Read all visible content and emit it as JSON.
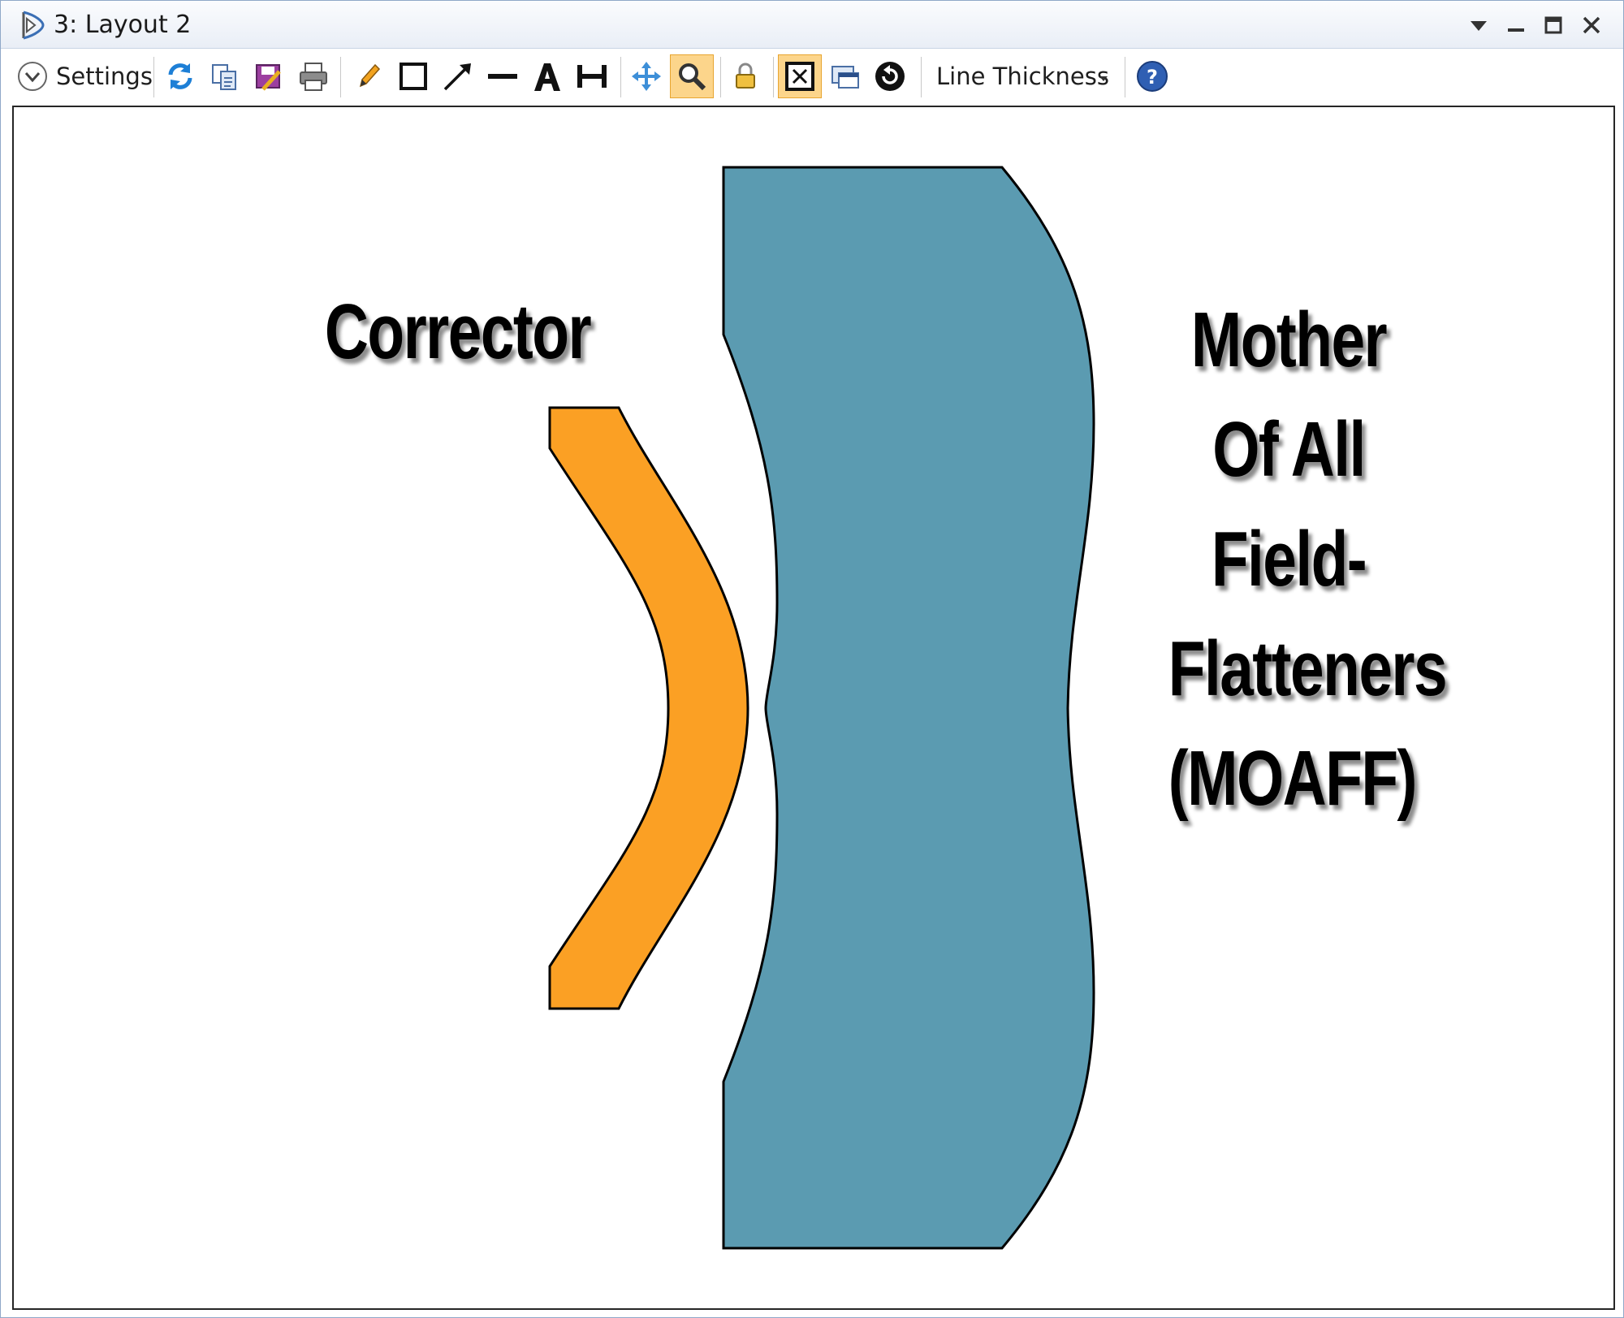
{
  "window": {
    "title": "3: Layout 2",
    "controls": [
      "chevron-down-icon",
      "minimize-icon",
      "maximize-icon",
      "close-icon"
    ]
  },
  "toolbar": {
    "settings_label": "Settings",
    "line_thickness_label": "Line Thickness",
    "icons": [
      "refresh-icon",
      "copy-icon",
      "save-icon",
      "print-icon",
      "pencil-icon",
      "rectangle-icon",
      "arrow-icon",
      "line-icon",
      "text-icon",
      "dimension-icon",
      "pan-icon",
      "zoom-icon",
      "lock-icon",
      "fit-icon",
      "window-icon",
      "reset-icon",
      "help-icon"
    ],
    "active": [
      "zoom-icon",
      "fit-icon"
    ]
  },
  "diagram": {
    "corrector_label": "Corrector",
    "moaff_label_lines": [
      "Mother",
      "Of All",
      "Field-",
      "Flatteners",
      "(MOAFF)"
    ],
    "colors": {
      "corrector_fill": "#fba024",
      "moaff_fill": "#5b9bb1",
      "outline": "#000000"
    }
  }
}
